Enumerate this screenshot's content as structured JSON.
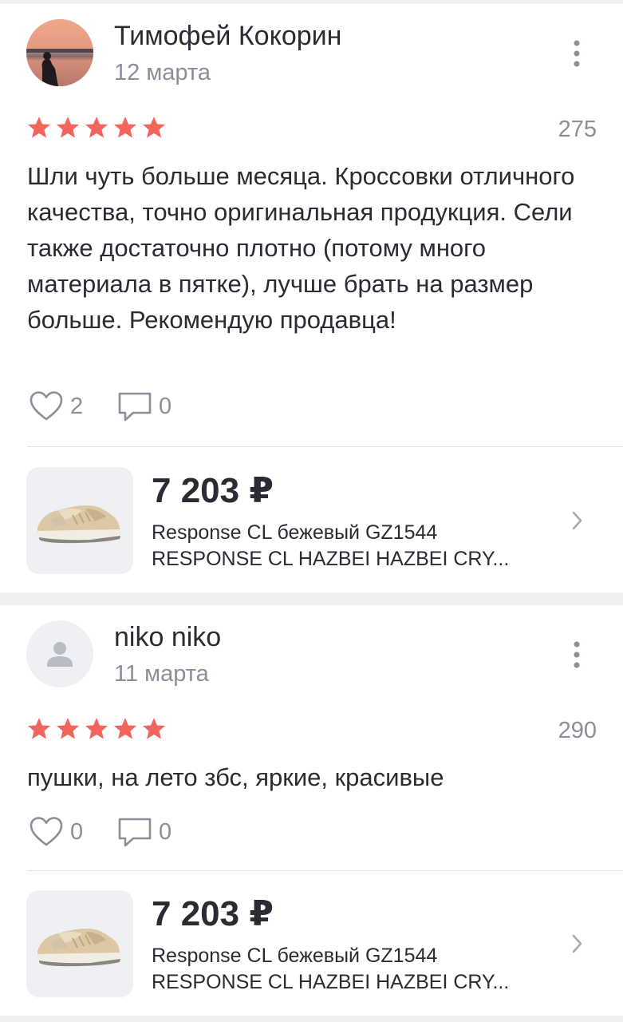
{
  "reviews": [
    {
      "author": "Тимофей Кокорин",
      "date": "12 марта",
      "rating": 5,
      "rating_count": "275",
      "text": "Шли чуть больше месяца. Кроссовки отличного качества, точно оригинальная продукция. Сели также достаточно плотно (потому много материала в пятке), лучше брать на размер больше. Рекомендую продавца!",
      "likes": "2",
      "comments": "0",
      "avatar": "sunset-photo",
      "product": {
        "price": "7 203 ₽",
        "name_line1": "Response CL бежевый GZ1544",
        "name_line2": "RESPONSE CL HAZBEI HAZBEI CRY..."
      }
    },
    {
      "author": "niko niko",
      "date": "11 марта",
      "rating": 5,
      "rating_count": "290",
      "text": "пушки, на лето збс, яркие, красивые",
      "likes": "0",
      "comments": "0",
      "avatar": "user-placeholder-icon",
      "product": {
        "price": "7 203 ₽",
        "name_line1": "Response CL бежевый GZ1544",
        "name_line2": "RESPONSE CL HAZBEI HAZBEI CRY..."
      }
    }
  ],
  "colors": {
    "star": "#f2655c",
    "text": "#2a2b33",
    "muted": "#8c8e99",
    "background": "#eef0f4"
  },
  "icons": {
    "more": "more-vertical-icon",
    "like": "heart-icon",
    "comment": "comment-icon",
    "chevron": "chevron-right-icon",
    "star": "star-icon"
  }
}
